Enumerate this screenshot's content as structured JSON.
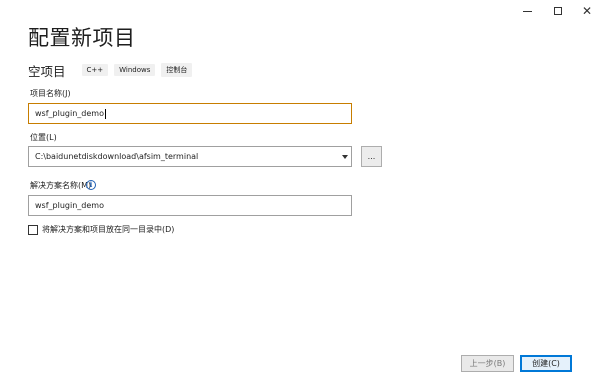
{
  "window": {
    "minimize_label": "",
    "maximize_label": "",
    "close_label": "✕"
  },
  "page_title": "配置新项目",
  "template": {
    "name": "空项目",
    "tags": [
      "C++",
      "Windows",
      "控制台"
    ]
  },
  "project_name": {
    "label": "项目名称(J)",
    "value": "wsf_plugin_demo"
  },
  "location": {
    "label": "位置(L)",
    "value": "C:\\baidunetdiskdownload\\afsim_terminal",
    "browse_label": "..."
  },
  "solution_name": {
    "label": "解决方案名称(M)",
    "info_icon": "i",
    "value": "wsf_plugin_demo"
  },
  "same_directory": {
    "label": "将解决方案和项目放在同一目录中(D)",
    "checked": false
  },
  "footer": {
    "back_label": "上一步(B)",
    "create_label": "创建(C)"
  },
  "colors": {
    "accent": "#0078d7",
    "focus_border": "#c77d00",
    "info": "#1e5fb4"
  }
}
